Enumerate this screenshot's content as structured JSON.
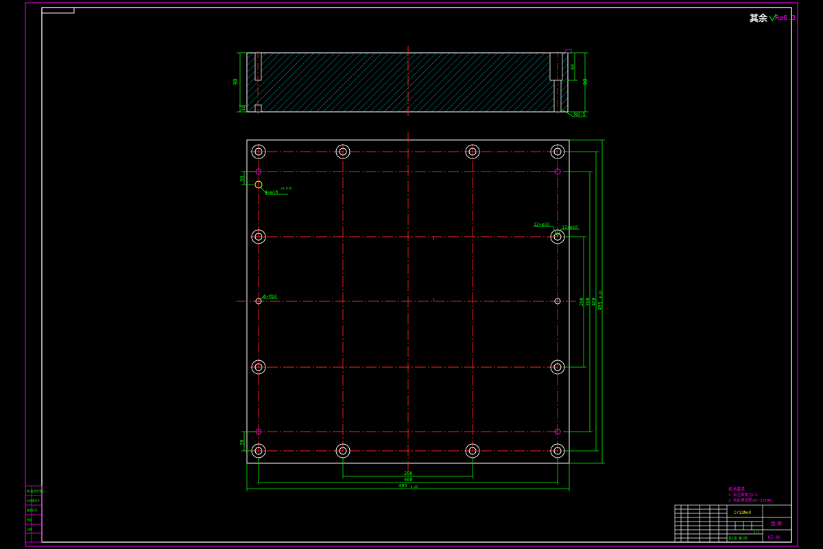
{
  "drawing": {
    "surface_finish": {
      "prefix": "其余",
      "value": "Ra6.3"
    },
    "section_view": {
      "height_left": "90",
      "height_right": "90",
      "slot_dim": "40",
      "bottom_dim": "10",
      "radius": "R0.5"
    },
    "plan_view": {
      "dims": {
        "bottom_inner": "200",
        "bottom_mid": "460",
        "bottom_outer": "495",
        "bottom_outer_tol": "-0.05",
        "right_inner": "200",
        "right_mid": "380",
        "right_mid2": "460",
        "right_outer": "495",
        "right_outer_tol": "-0.05",
        "left_top_offset": "30",
        "left_bottom_offset": "30"
      },
      "callouts": {
        "pin_holes": "4×φ10",
        "pin_holes_tol": "+0.018",
        "counterbore_a": "12×φ32",
        "counterbore_b": "12×φ18",
        "thread_holes": "6×M10"
      }
    },
    "tech_notes": {
      "title": "技术要求",
      "line1": "1. 未注倒角为C1;",
      "line2": "2. 热处理调质28~32HRC。"
    },
    "title_block": {
      "material": "Cr12MoV",
      "part_name": "垫 板",
      "drawing_no": "KZ-06",
      "scale": "1:1",
      "sheet": "共1张 第1张"
    },
    "binding_column": [
      "借(通)用件登记",
      "旧底图总号",
      "底图总号",
      "签字",
      "日期"
    ]
  },
  "colors": {
    "frame": "#ff00ff",
    "outline": "#ffffff",
    "center": "#ff2020",
    "dimension": "#00ff00",
    "hatch": "#00c8c8",
    "border": "#ffffff"
  }
}
